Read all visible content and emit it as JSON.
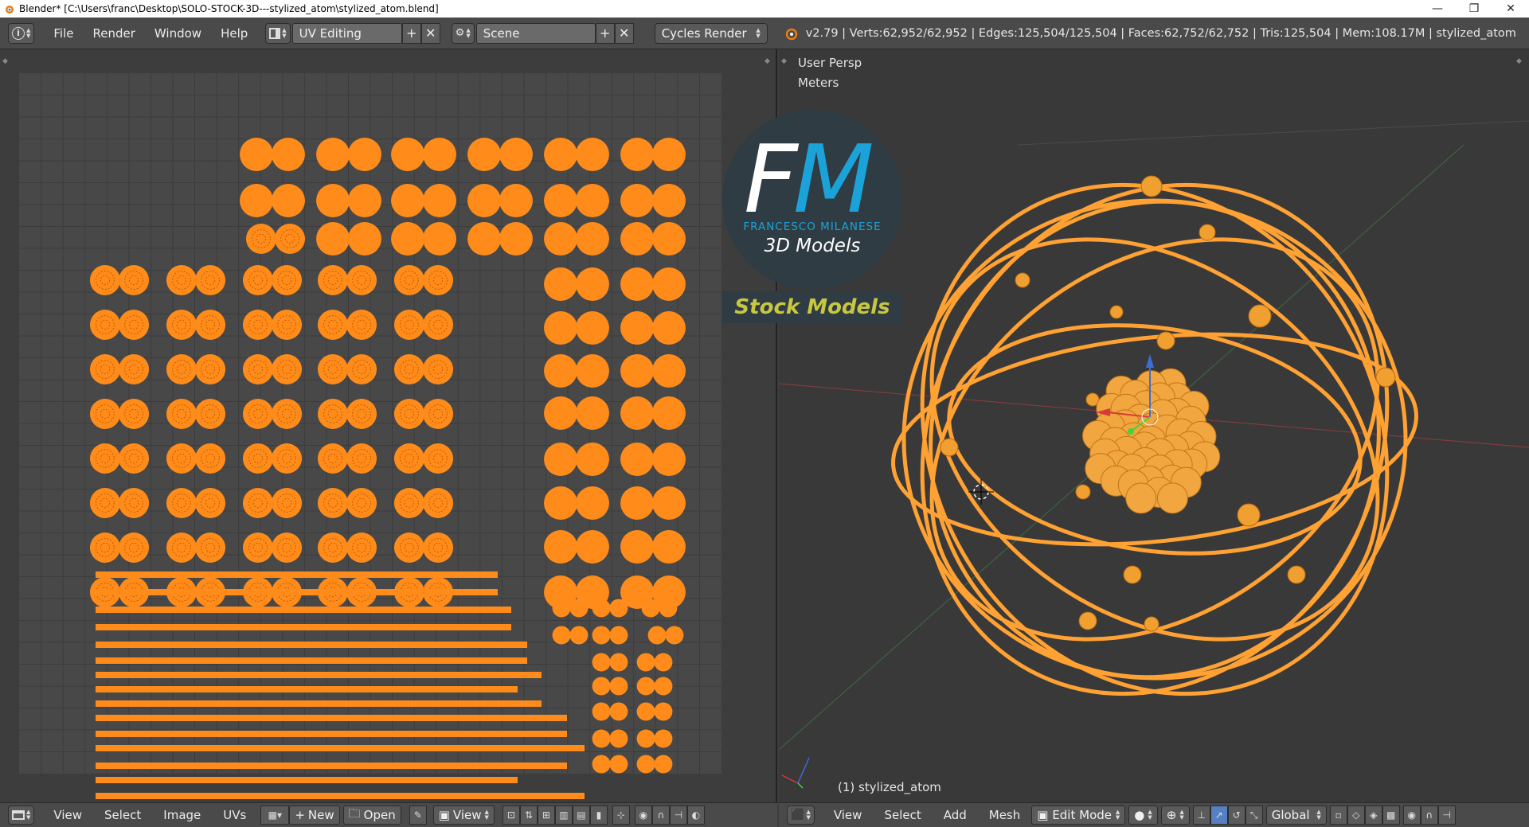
{
  "titlebar": {
    "title": "Blender* [C:\\Users\\franc\\Desktop\\SOLO-STOCK-3D---stylized_atom\\stylized_atom.blend]",
    "minimize": "—",
    "maximize": "❐",
    "close": "✕"
  },
  "infobar": {
    "menus": [
      "File",
      "Render",
      "Window",
      "Help"
    ],
    "screen_layout": "UV Editing",
    "scene": "Scene",
    "render_engine": "Cycles Render",
    "stats": "v2.79 | Verts:62,952/62,952 | Edges:125,504/125,504 | Faces:62,752/62,752 | Tris:125,504 | Mem:108.17M | stylized_atom"
  },
  "viewport": {
    "view_label": "User Persp",
    "units_label": "Meters",
    "object_label": "(1) stylized_atom"
  },
  "logo": {
    "letter_f": "F",
    "letter_m": "M",
    "name": "FRANCESCO MILANESE",
    "subtitle": "3D Models",
    "banner": "Stock Models",
    "colors": {
      "circle": "#2f3c44",
      "accent": "#1ba3d9",
      "banner_text": "#c9c73f"
    }
  },
  "uv_bottom": {
    "menus": [
      "View",
      "Select",
      "Image",
      "UVs"
    ],
    "new_label": "New",
    "open_label": "Open",
    "view_label": "View"
  },
  "vp_bottom": {
    "menus": [
      "View",
      "Select",
      "Add",
      "Mesh"
    ],
    "mode": "Edit Mode",
    "orientation": "Global"
  },
  "colors": {
    "uv_island": "#ff8c1a",
    "mesh_wire": "#ffa233",
    "header": "#4a4a4a"
  }
}
